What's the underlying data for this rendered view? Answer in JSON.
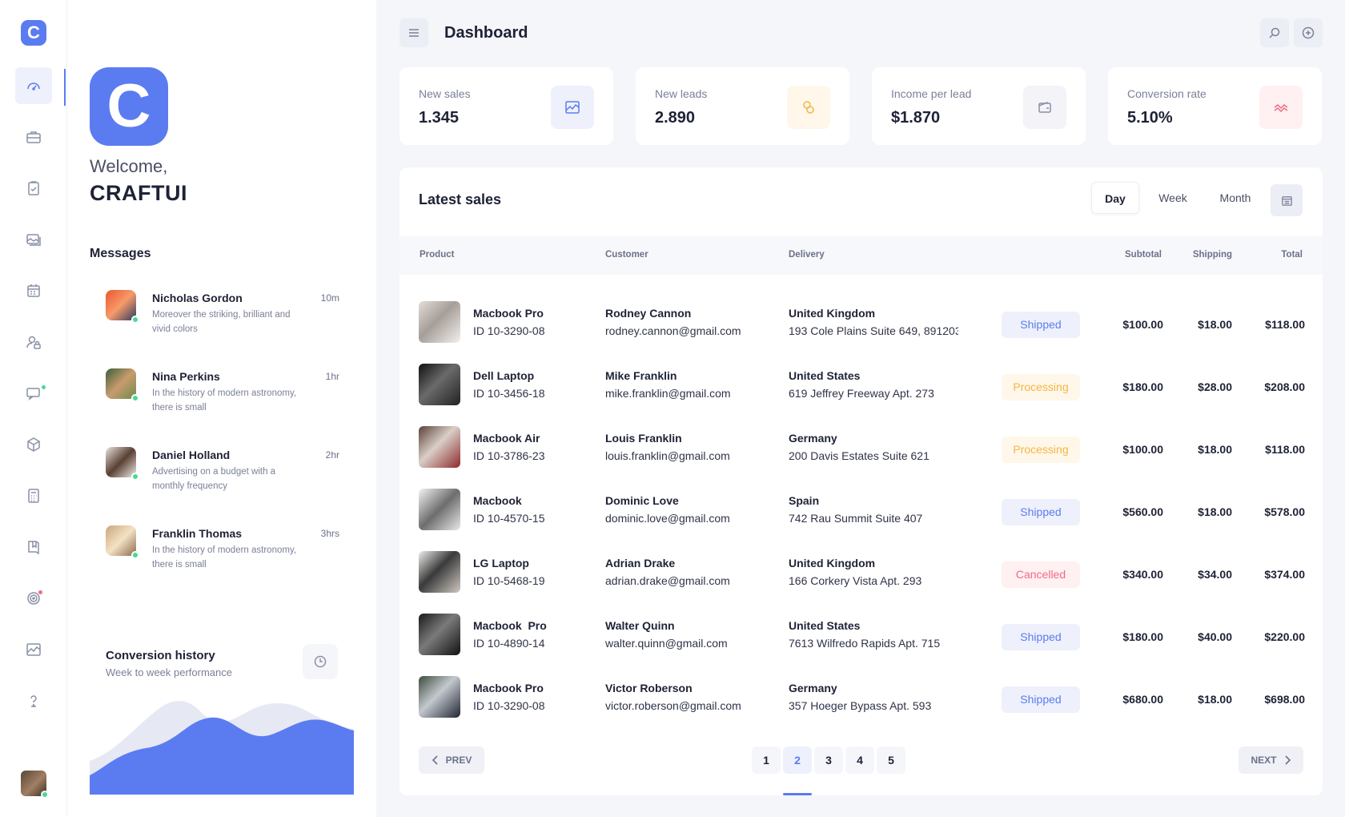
{
  "rail": {
    "logo_letter": "C",
    "items": [
      {
        "icon": "dashboard-gauge-icon"
      },
      {
        "icon": "briefcase-icon"
      },
      {
        "icon": "clipboard-check-icon"
      },
      {
        "icon": "gallery-icon"
      },
      {
        "icon": "calendar-icon"
      },
      {
        "icon": "user-lock-icon"
      },
      {
        "icon": "chat-icon"
      },
      {
        "icon": "box-icon"
      },
      {
        "icon": "calculator-icon"
      },
      {
        "icon": "book-icon"
      },
      {
        "icon": "target-icon"
      },
      {
        "icon": "chart-icon"
      },
      {
        "icon": "help-icon"
      }
    ],
    "accent_color": "#5b7cf0"
  },
  "panel": {
    "logo_letter": "C",
    "welcome": "Welcome,",
    "brand": "CRAFTUI",
    "messages_title": "Messages",
    "messages": [
      {
        "name": "Nicholas Gordon",
        "time": "10m",
        "text": "Moreover the striking, brilliant and vivid colors"
      },
      {
        "name": "Nina Perkins",
        "time": "1hr",
        "text": "In the history of modern astronomy, there is small"
      },
      {
        "name": "Daniel Holland",
        "time": "2hr",
        "text": "Advertising on a budget with a monthly frequency"
      },
      {
        "name": "Franklin Thomas",
        "time": "3hrs",
        "text": "In the history of modern astronomy, there is small"
      }
    ],
    "conversion": {
      "title": "Conversion history",
      "subtitle": "Week to week performance",
      "series_front_color": "#5b7cf0",
      "series_back_color": "#e6e8f3"
    }
  },
  "header": {
    "title": "Dashboard"
  },
  "stats": [
    {
      "label": "New sales",
      "value": "1.345",
      "icon": "chart-area-icon",
      "color": "#5b7cf0",
      "bg": "#eef1fb"
    },
    {
      "label": "New leads",
      "value": "2.890",
      "icon": "coins-icon",
      "color": "#f5b545",
      "bg": "#fff7e9"
    },
    {
      "label": "Income per lead",
      "value": "$1.870",
      "icon": "wallet-icon",
      "color": "#8a90a6",
      "bg": "#f3f3f8"
    },
    {
      "label": "Conversion rate",
      "value": "5.10%",
      "icon": "trend-icon",
      "color": "#f06b84",
      "bg": "#fff0f2"
    }
  ],
  "sales": {
    "title": "Latest sales",
    "periods": [
      "Day",
      "Week",
      "Month"
    ],
    "active_period": "Day",
    "columns": {
      "product": "Product",
      "customer": "Customer",
      "delivery": "Delivery",
      "subtotal": "Subtotal",
      "shipping": "Shipping",
      "total": "Total"
    },
    "rows": [
      {
        "product": "Macbook Pro",
        "id": "ID 10-3290-08",
        "customer": "Rodney Cannon",
        "email": "rodney.cannon@gmail.com",
        "country": "United Kingdom",
        "address": "193 Cole Plains Suite 649, 891203",
        "status": "Shipped",
        "subtotal": "$100.00",
        "shipping": "$18.00",
        "total": "$118.00"
      },
      {
        "product": "Dell Laptop",
        "id": "ID 10-3456-18",
        "customer": "Mike Franklin",
        "email": "mike.franklin@gmail.com",
        "country": "United States",
        "address": "619 Jeffrey Freeway Apt. 273",
        "status": "Processing",
        "subtotal": "$180.00",
        "shipping": "$28.00",
        "total": "$208.00"
      },
      {
        "product": "Macbook Air",
        "id": "ID 10-3786-23",
        "customer": "Louis Franklin",
        "email": "louis.franklin@gmail.com",
        "country": "Germany",
        "address": "200 Davis Estates Suite 621",
        "status": "Processing",
        "subtotal": "$100.00",
        "shipping": "$18.00",
        "total": "$118.00"
      },
      {
        "product": "Macbook",
        "id": "ID 10-4570-15",
        "customer": "Dominic Love",
        "email": "dominic.love@gmail.com",
        "country": "Spain",
        "address": "742 Rau Summit Suite 407",
        "status": "Shipped",
        "subtotal": "$560.00",
        "shipping": "$18.00",
        "total": "$578.00"
      },
      {
        "product": "LG Laptop",
        "id": "ID 10-5468-19",
        "customer": "Adrian Drake",
        "email": "adrian.drake@gmail.com",
        "country": "United Kingdom",
        "address": "166 Corkery Vista Apt. 293",
        "status": "Cancelled",
        "subtotal": "$340.00",
        "shipping": "$34.00",
        "total": "$374.00"
      },
      {
        "product": "Macbook  Pro",
        "id": "ID 10-4890-14",
        "customer": "Walter Quinn",
        "email": "walter.quinn@gmail.com",
        "country": "United States",
        "address": "7613 Wilfredo Rapids Apt. 715",
        "status": "Shipped",
        "subtotal": "$180.00",
        "shipping": "$40.00",
        "total": "$220.00"
      },
      {
        "product": "Macbook Pro",
        "id": "ID 10-3290-08",
        "customer": "Victor Roberson",
        "email": "victor.roberson@gmail.com",
        "country": "Germany",
        "address": "357 Hoeger Bypass Apt. 593",
        "status": "Shipped",
        "subtotal": "$680.00",
        "shipping": "$18.00",
        "total": "$698.00"
      }
    ],
    "pagination": {
      "prev": "PREV",
      "next": "NEXT",
      "pages": [
        "1",
        "2",
        "3",
        "4",
        "5"
      ],
      "current": "2"
    }
  },
  "colors": {
    "shipped": "#5b7cf0",
    "processing": "#f5b545",
    "cancelled": "#f06b84",
    "online": "#4ad991"
  }
}
